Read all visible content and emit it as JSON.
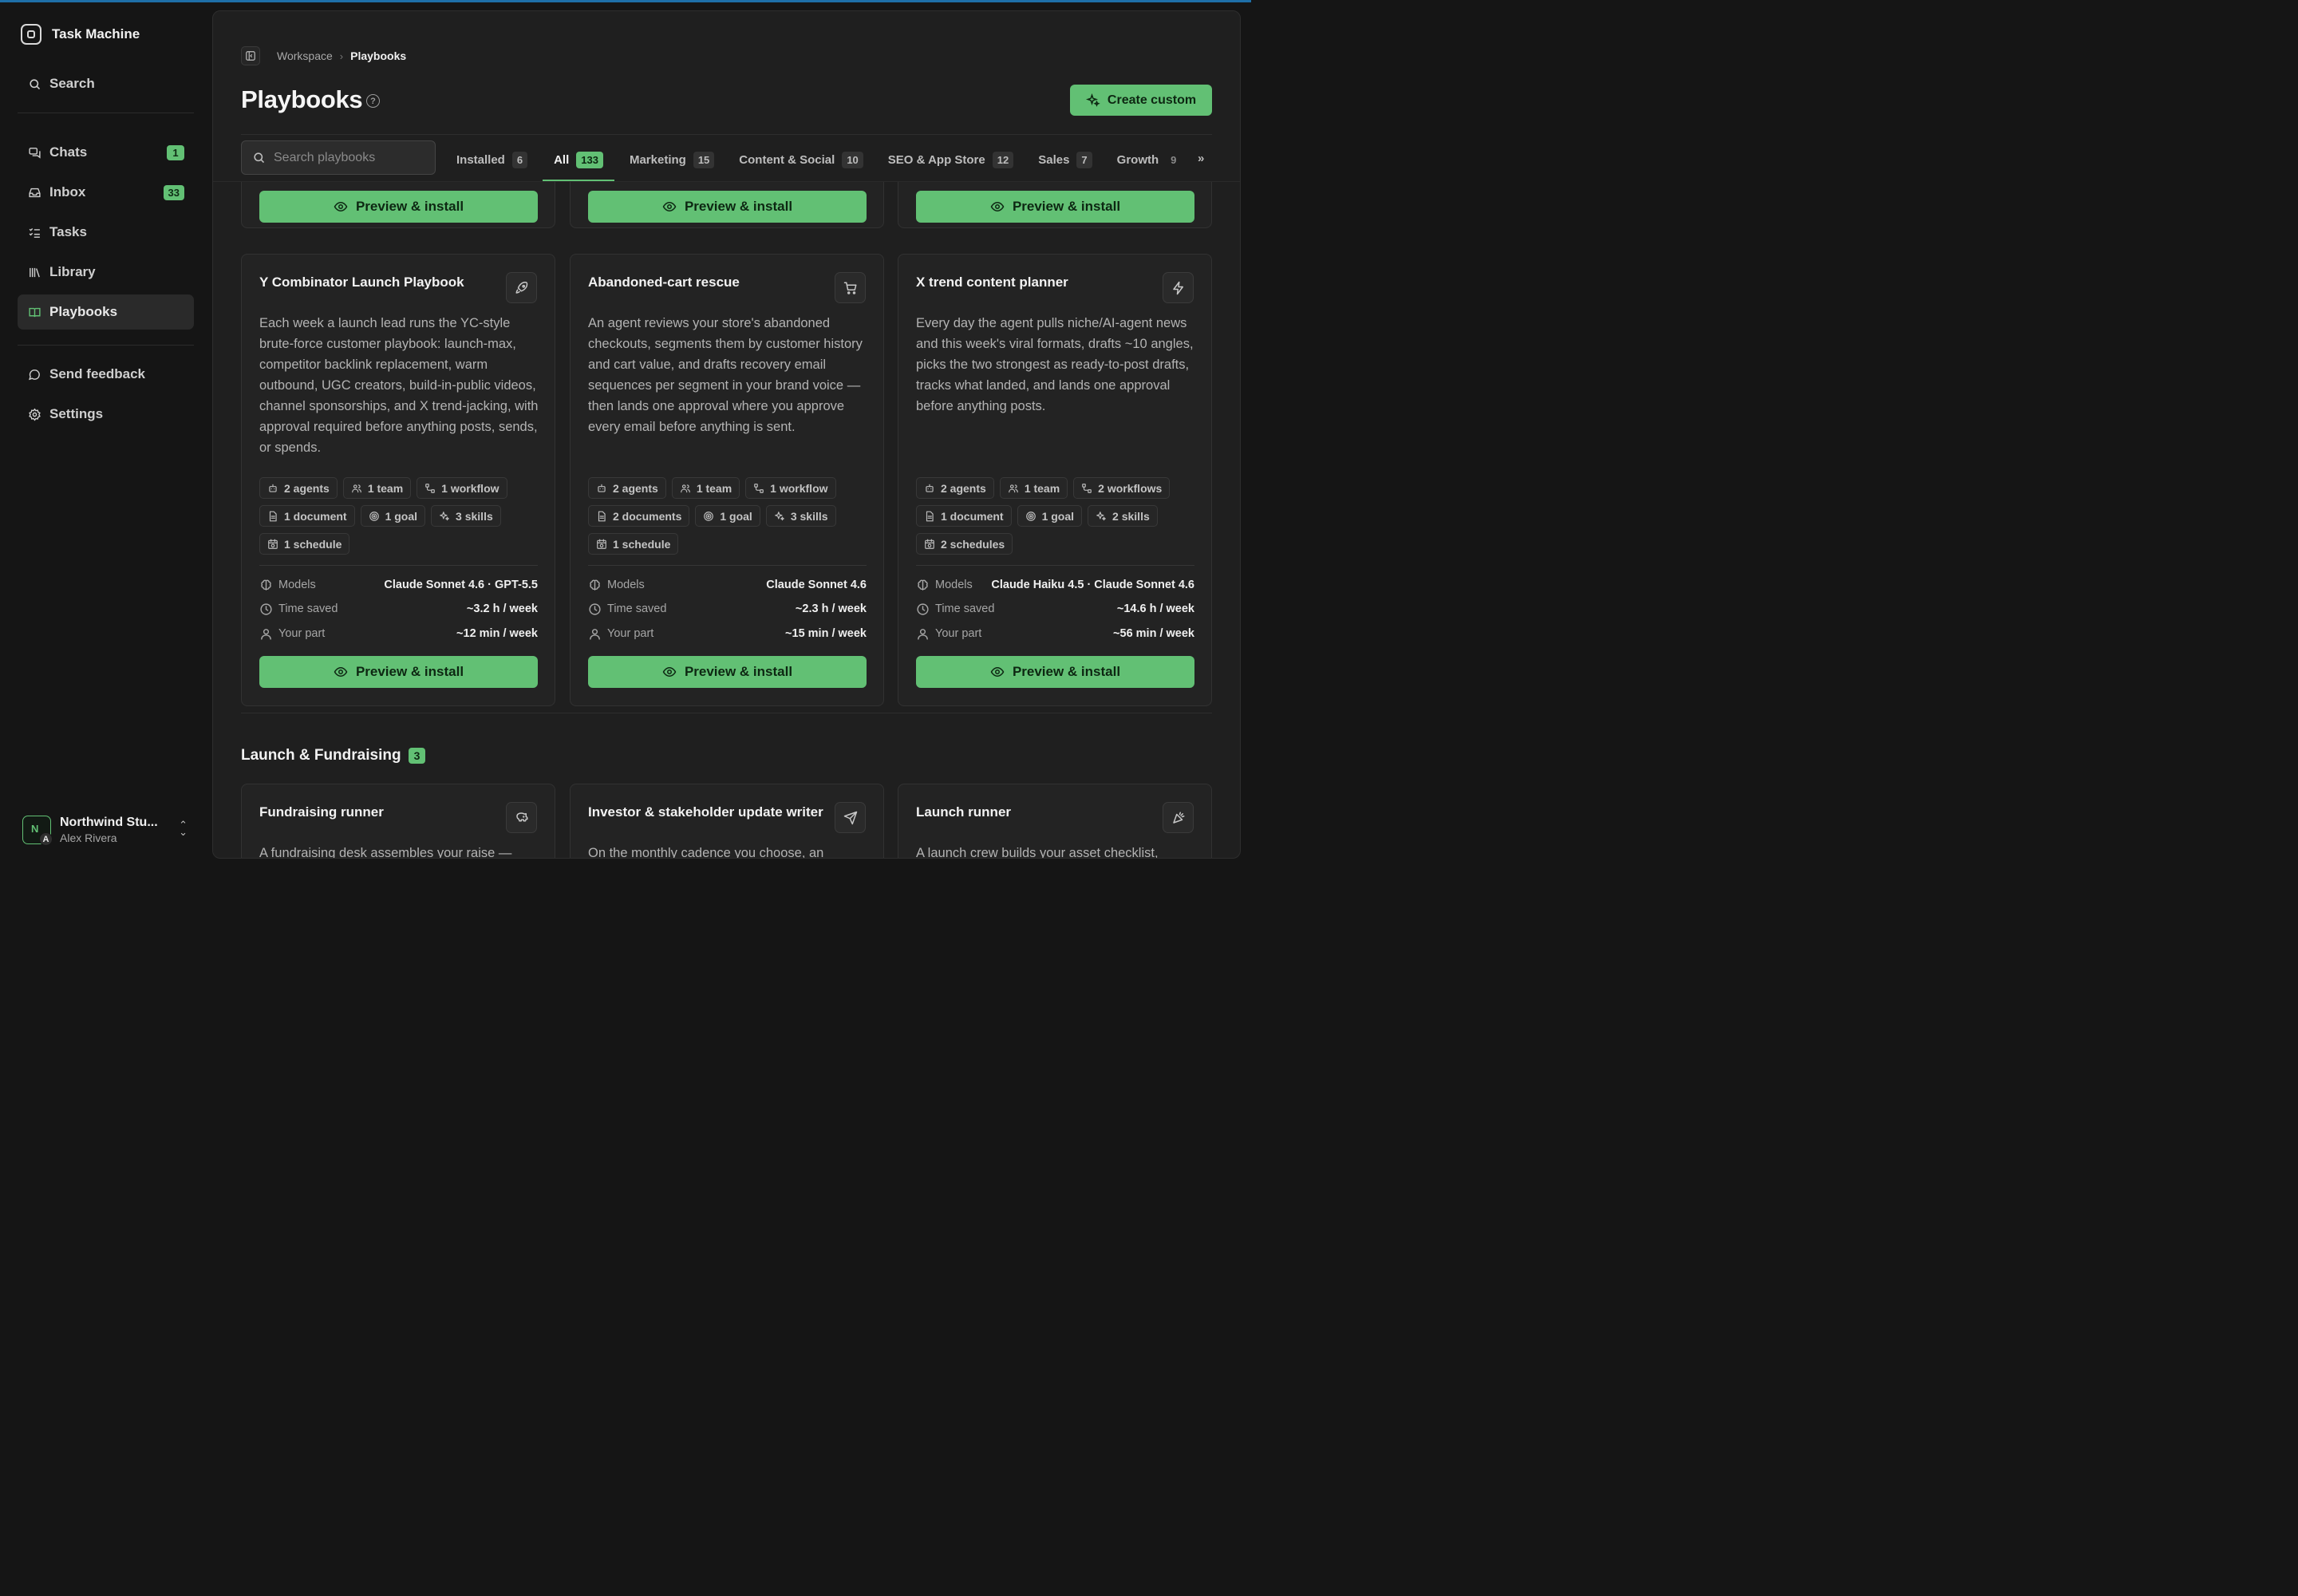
{
  "app": {
    "name": "Task Machine"
  },
  "sidebar": {
    "search_label": "Search",
    "items": [
      {
        "label": "Chats",
        "badge": "1",
        "icon": "chats-icon"
      },
      {
        "label": "Inbox",
        "badge": "33",
        "icon": "inbox-icon"
      },
      {
        "label": "Tasks",
        "icon": "tasks-icon"
      },
      {
        "label": "Library",
        "icon": "library-icon"
      },
      {
        "label": "Playbooks",
        "icon": "playbooks-icon"
      }
    ],
    "footer_items": [
      {
        "label": "Send feedback",
        "icon": "feedback-icon"
      },
      {
        "label": "Settings",
        "icon": "gear-icon"
      }
    ],
    "account": {
      "org": "Northwind Stu...",
      "user": "Alex Rivera",
      "initial_org": "N",
      "initial_user": "A"
    }
  },
  "header": {
    "breadcrumb": [
      "Workspace",
      "Playbooks"
    ],
    "title": "Playbooks",
    "help": "?",
    "create_button": "Create custom"
  },
  "search": {
    "placeholder": "Search playbooks"
  },
  "tabs": [
    {
      "label": "Installed",
      "count": "6"
    },
    {
      "label": "All",
      "count": "133",
      "active": true
    },
    {
      "label": "Marketing",
      "count": "15"
    },
    {
      "label": "Content & Social",
      "count": "10"
    },
    {
      "label": "SEO & App Store",
      "count": "12"
    },
    {
      "label": "Sales",
      "count": "7"
    },
    {
      "label": "Growth",
      "count": "9"
    }
  ],
  "tabs_more": "»",
  "preview_label": "Preview & install",
  "cards": [
    {
      "title": "Y Combinator Launch Playbook",
      "icon": "rocket-icon",
      "description": "Each week a launch lead runs the YC-style brute-force customer playbook: launch-max, competitor backlink replacement, warm outbound, UGC creators, build-in-public videos, channel sponsorships, and X trend-jacking, with approval required before anything posts, sends, or spends.",
      "chips": [
        "2 agents",
        "1 team",
        "1 workflow",
        "1 document",
        "1 goal",
        "3 skills",
        "1 schedule"
      ],
      "models": "Claude Sonnet 4.6 · GPT-5.5",
      "time_saved": "~3.2 h / week",
      "your_part": "~12 min / week"
    },
    {
      "title": "Abandoned-cart rescue",
      "icon": "cart-icon",
      "description": "An agent reviews your store's abandoned checkouts, segments them by customer history and cart value, and drafts recovery email sequences per segment in your brand voice — then lands one approval where you approve every email before anything is sent.",
      "chips": [
        "2 agents",
        "1 team",
        "1 workflow",
        "2 documents",
        "1 goal",
        "3 skills",
        "1 schedule"
      ],
      "models": "Claude Sonnet 4.6",
      "time_saved": "~2.3 h / week",
      "your_part": "~15 min / week"
    },
    {
      "title": "X trend content planner",
      "icon": "bolt-icon",
      "description": "Every day the agent pulls niche/AI-agent news and this week's viral formats, drafts ~10 angles, picks the two strongest as ready-to-post drafts, tracks what landed, and lands one approval before anything posts.",
      "chips": [
        "2 agents",
        "1 team",
        "2 workflows",
        "1 document",
        "1 goal",
        "2 skills",
        "2 schedules"
      ],
      "models": "Claude Haiku 4.5 · Claude Sonnet 4.6",
      "time_saved": "~14.6 h / week",
      "your_part": "~56 min / week"
    }
  ],
  "meta_labels": {
    "models": "Models",
    "time_saved": "Time saved",
    "your_part": "Your part"
  },
  "section": {
    "title": "Launch & Fundraising",
    "count": "3",
    "cards": [
      {
        "title": "Fundraising runner",
        "icon": "piggy-bank-icon",
        "description": "A fundraising desk assembles your raise —"
      },
      {
        "title": "Investor & stakeholder update writer",
        "icon": "send-icon",
        "description": "On the monthly cadence you choose, an"
      },
      {
        "title": "Launch runner",
        "icon": "party-popper-icon",
        "description": "A launch crew builds your asset checklist,"
      }
    ]
  },
  "colors": {
    "accent": "#62c074",
    "topbar": "#1e6fa8",
    "background": "#151515",
    "panel": "#1f1f1f"
  }
}
